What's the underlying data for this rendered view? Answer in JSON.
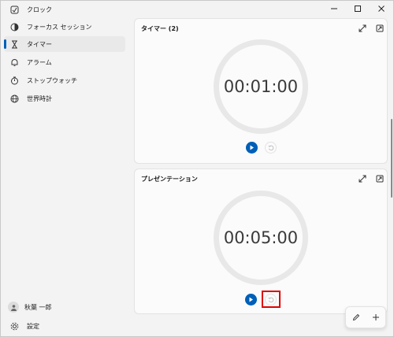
{
  "sidebar": {
    "items": [
      {
        "label": "クロック",
        "icon": "clock-icon"
      },
      {
        "label": "フォーカス セッション",
        "icon": "focus-icon"
      },
      {
        "label": "タイマー",
        "icon": "hourglass-icon"
      },
      {
        "label": "アラーム",
        "icon": "bell-icon"
      },
      {
        "label": "ストップウォッチ",
        "icon": "stopwatch-icon"
      },
      {
        "label": "世界時計",
        "icon": "globe-icon"
      }
    ],
    "selected": "タイマー",
    "account_name": "秋葉 一郎",
    "settings_label": "設定"
  },
  "timers": [
    {
      "name": "タイマー (2)",
      "time": "00:01:00"
    },
    {
      "name": "プレゼンテーション",
      "time": "00:05:00"
    }
  ],
  "colors": {
    "accent": "#005fb8",
    "highlight": "#e00000",
    "ring": "#e8e8e8",
    "background": "#f3f3f3",
    "card": "#fbfbfb"
  },
  "icons": {
    "window": [
      "minimize-icon",
      "maximize-icon",
      "close-icon"
    ],
    "card": [
      "expand-icon",
      "keep-on-top-icon",
      "play-icon",
      "reset-icon"
    ],
    "toolbar": [
      "edit-icon",
      "add-icon"
    ]
  }
}
